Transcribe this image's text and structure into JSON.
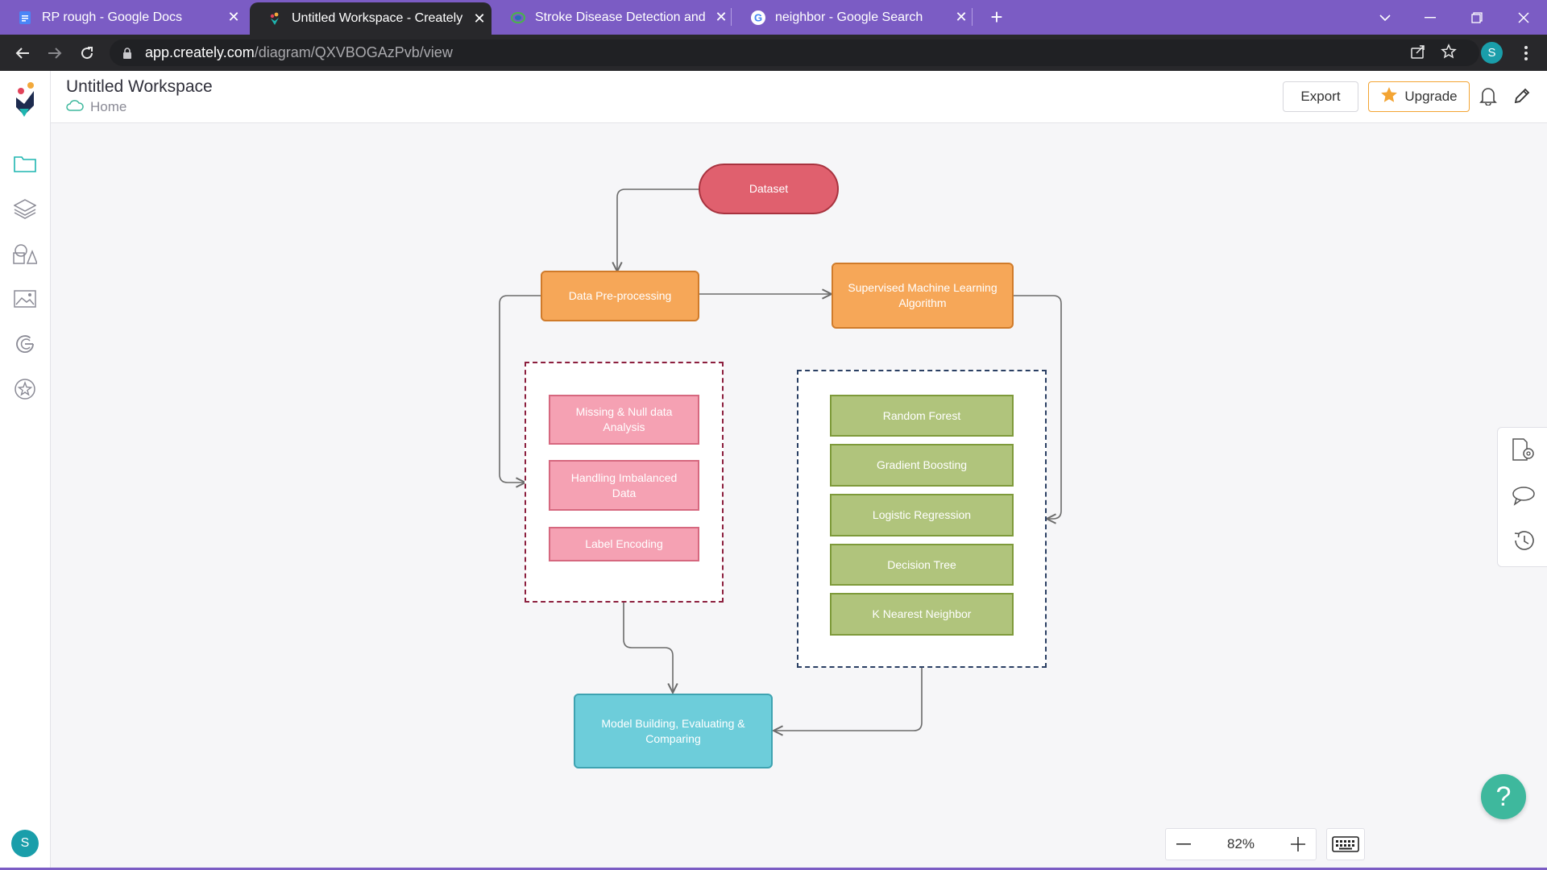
{
  "browser": {
    "tabs": [
      {
        "title": "RP rough - Google Docs",
        "icon": "google-docs-icon",
        "active": false
      },
      {
        "title": "Untitled Workspace - Creately",
        "icon": "creately-icon",
        "active": true
      },
      {
        "title": "Stroke Disease Detection and Pre",
        "icon": "overleaf-icon",
        "active": false
      },
      {
        "title": "neighbor - Google Search",
        "icon": "google-icon",
        "active": false
      }
    ],
    "url_host": "app.creately.com",
    "url_path": "/diagram/QXVBOGAzPvb/view",
    "profile_initial": "S",
    "theme_color": "#7b5cc4"
  },
  "app": {
    "workspace_title": "Untitled Workspace",
    "breadcrumb_home": "Home",
    "export_label": "Export",
    "upgrade_label": "Upgrade",
    "user_initial": "S",
    "zoom": "82%",
    "help_label": "?"
  },
  "diagram": {
    "dataset": "Dataset",
    "preprocessing": "Data Pre-processing",
    "supervised": "Supervised Machine Learning Algorithm",
    "preprocessing_steps": [
      "Missing & Null data Analysis",
      "Handling Imbalanced Data",
      "Label Encoding"
    ],
    "algorithms": [
      "Random Forest",
      "Gradient Boosting",
      "Logistic Regression",
      "Decision Tree",
      "K Nearest Neighbor"
    ],
    "model": "Model Building, Evaluating & Comparing",
    "colors": {
      "dataset": "#e0606e",
      "process": "#f6a758",
      "steps": "#f5a1b3",
      "algorithms": "#b0c47c",
      "model": "#6dcdda"
    }
  }
}
